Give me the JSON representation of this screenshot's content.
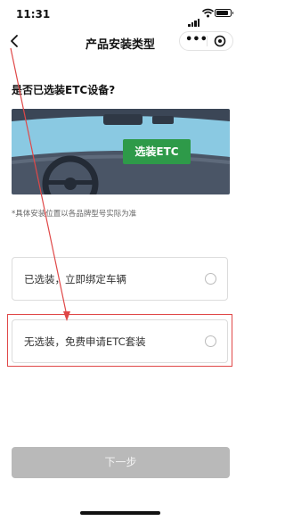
{
  "status_bar": {
    "time": "11:31"
  },
  "header": {
    "title": "产品安装类型",
    "more_icon": "•••"
  },
  "question": "是否已选装ETC设备?",
  "banner": {
    "tag_label": "选装ETC"
  },
  "note": "*具体安装位置以各品牌型号实际为准",
  "options": [
    {
      "label": "已选装，立即绑定车辆",
      "selected": false
    },
    {
      "label": "无选装，免费申请ETC套装",
      "selected": false
    }
  ],
  "next_button": {
    "label": "下一步",
    "enabled": false
  },
  "colors": {
    "accent_green": "#2e9a49",
    "highlight_red": "#e04848",
    "disabled_button": "#b9b9b9"
  }
}
